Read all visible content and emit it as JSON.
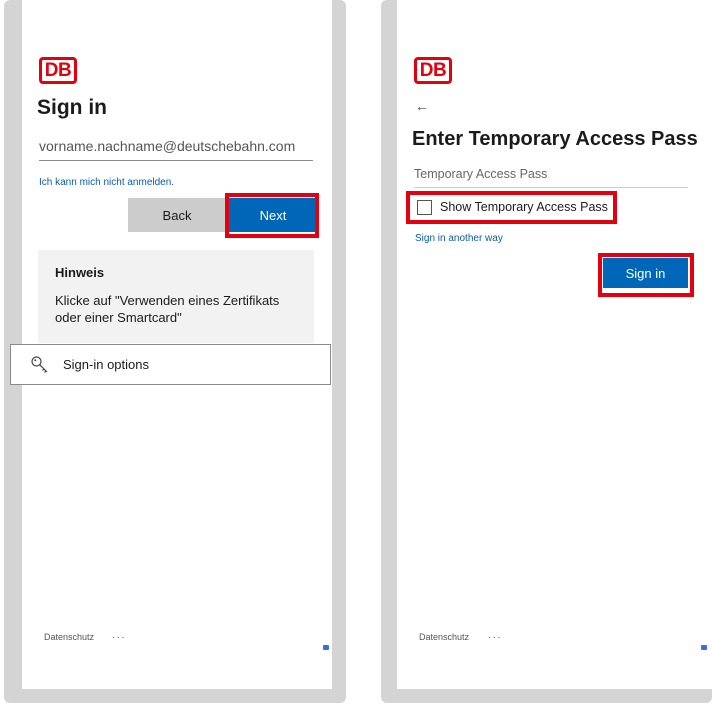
{
  "left": {
    "logo": "DB",
    "title": "Sign in",
    "email_value": "vorname.nachname@deutschebahn.com",
    "cant_sign_in_link": "Ich kann mich nicht anmelden.",
    "back_label": "Back",
    "next_label": "Next",
    "hint_title": "Hinweis",
    "hint_text": "Klicke auf \"Verwenden eines Zertifikats oder einer Smartcard\"",
    "sign_in_options_label": "Sign-in options",
    "footer_privacy": "Datenschutz",
    "footer_more": "..."
  },
  "right": {
    "logo": "DB",
    "back_arrow": "←",
    "title": "Enter Temporary Access Pass",
    "tap_placeholder": "Temporary Access Pass",
    "show_tap_label": "Show Temporary Access Pass",
    "sign_in_another_way": "Sign in another way",
    "sign_in_label": "Sign in",
    "footer_privacy": "Datenschutz",
    "footer_more": "..."
  },
  "colors": {
    "db_red": "#e3000f",
    "primary_blue": "#0067b8",
    "link_blue": "#0b5cad",
    "highlight_red": "#e3000f"
  }
}
